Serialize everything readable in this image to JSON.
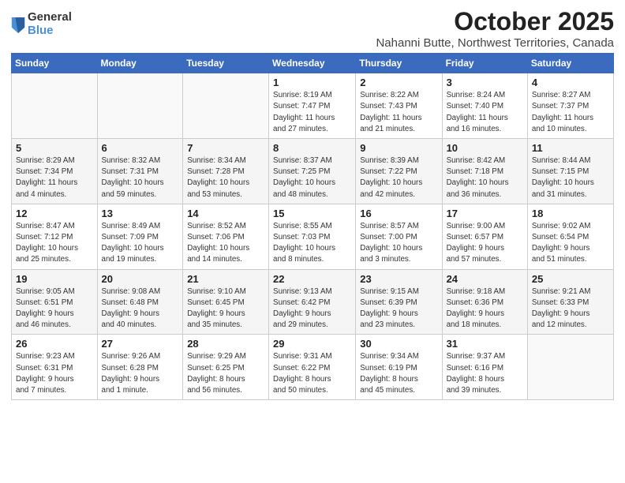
{
  "header": {
    "logo_general": "General",
    "logo_blue": "Blue",
    "month": "October 2025",
    "location": "Nahanni Butte, Northwest Territories, Canada"
  },
  "weekdays": [
    "Sunday",
    "Monday",
    "Tuesday",
    "Wednesday",
    "Thursday",
    "Friday",
    "Saturday"
  ],
  "weeks": [
    [
      {
        "day": "",
        "info": ""
      },
      {
        "day": "",
        "info": ""
      },
      {
        "day": "",
        "info": ""
      },
      {
        "day": "1",
        "info": "Sunrise: 8:19 AM\nSunset: 7:47 PM\nDaylight: 11 hours\nand 27 minutes."
      },
      {
        "day": "2",
        "info": "Sunrise: 8:22 AM\nSunset: 7:43 PM\nDaylight: 11 hours\nand 21 minutes."
      },
      {
        "day": "3",
        "info": "Sunrise: 8:24 AM\nSunset: 7:40 PM\nDaylight: 11 hours\nand 16 minutes."
      },
      {
        "day": "4",
        "info": "Sunrise: 8:27 AM\nSunset: 7:37 PM\nDaylight: 11 hours\nand 10 minutes."
      }
    ],
    [
      {
        "day": "5",
        "info": "Sunrise: 8:29 AM\nSunset: 7:34 PM\nDaylight: 11 hours\nand 4 minutes."
      },
      {
        "day": "6",
        "info": "Sunrise: 8:32 AM\nSunset: 7:31 PM\nDaylight: 10 hours\nand 59 minutes."
      },
      {
        "day": "7",
        "info": "Sunrise: 8:34 AM\nSunset: 7:28 PM\nDaylight: 10 hours\nand 53 minutes."
      },
      {
        "day": "8",
        "info": "Sunrise: 8:37 AM\nSunset: 7:25 PM\nDaylight: 10 hours\nand 48 minutes."
      },
      {
        "day": "9",
        "info": "Sunrise: 8:39 AM\nSunset: 7:22 PM\nDaylight: 10 hours\nand 42 minutes."
      },
      {
        "day": "10",
        "info": "Sunrise: 8:42 AM\nSunset: 7:18 PM\nDaylight: 10 hours\nand 36 minutes."
      },
      {
        "day": "11",
        "info": "Sunrise: 8:44 AM\nSunset: 7:15 PM\nDaylight: 10 hours\nand 31 minutes."
      }
    ],
    [
      {
        "day": "12",
        "info": "Sunrise: 8:47 AM\nSunset: 7:12 PM\nDaylight: 10 hours\nand 25 minutes."
      },
      {
        "day": "13",
        "info": "Sunrise: 8:49 AM\nSunset: 7:09 PM\nDaylight: 10 hours\nand 19 minutes."
      },
      {
        "day": "14",
        "info": "Sunrise: 8:52 AM\nSunset: 7:06 PM\nDaylight: 10 hours\nand 14 minutes."
      },
      {
        "day": "15",
        "info": "Sunrise: 8:55 AM\nSunset: 7:03 PM\nDaylight: 10 hours\nand 8 minutes."
      },
      {
        "day": "16",
        "info": "Sunrise: 8:57 AM\nSunset: 7:00 PM\nDaylight: 10 hours\nand 3 minutes."
      },
      {
        "day": "17",
        "info": "Sunrise: 9:00 AM\nSunset: 6:57 PM\nDaylight: 9 hours\nand 57 minutes."
      },
      {
        "day": "18",
        "info": "Sunrise: 9:02 AM\nSunset: 6:54 PM\nDaylight: 9 hours\nand 51 minutes."
      }
    ],
    [
      {
        "day": "19",
        "info": "Sunrise: 9:05 AM\nSunset: 6:51 PM\nDaylight: 9 hours\nand 46 minutes."
      },
      {
        "day": "20",
        "info": "Sunrise: 9:08 AM\nSunset: 6:48 PM\nDaylight: 9 hours\nand 40 minutes."
      },
      {
        "day": "21",
        "info": "Sunrise: 9:10 AM\nSunset: 6:45 PM\nDaylight: 9 hours\nand 35 minutes."
      },
      {
        "day": "22",
        "info": "Sunrise: 9:13 AM\nSunset: 6:42 PM\nDaylight: 9 hours\nand 29 minutes."
      },
      {
        "day": "23",
        "info": "Sunrise: 9:15 AM\nSunset: 6:39 PM\nDaylight: 9 hours\nand 23 minutes."
      },
      {
        "day": "24",
        "info": "Sunrise: 9:18 AM\nSunset: 6:36 PM\nDaylight: 9 hours\nand 18 minutes."
      },
      {
        "day": "25",
        "info": "Sunrise: 9:21 AM\nSunset: 6:33 PM\nDaylight: 9 hours\nand 12 minutes."
      }
    ],
    [
      {
        "day": "26",
        "info": "Sunrise: 9:23 AM\nSunset: 6:31 PM\nDaylight: 9 hours\nand 7 minutes."
      },
      {
        "day": "27",
        "info": "Sunrise: 9:26 AM\nSunset: 6:28 PM\nDaylight: 9 hours\nand 1 minute."
      },
      {
        "day": "28",
        "info": "Sunrise: 9:29 AM\nSunset: 6:25 PM\nDaylight: 8 hours\nand 56 minutes."
      },
      {
        "day": "29",
        "info": "Sunrise: 9:31 AM\nSunset: 6:22 PM\nDaylight: 8 hours\nand 50 minutes."
      },
      {
        "day": "30",
        "info": "Sunrise: 9:34 AM\nSunset: 6:19 PM\nDaylight: 8 hours\nand 45 minutes."
      },
      {
        "day": "31",
        "info": "Sunrise: 9:37 AM\nSunset: 6:16 PM\nDaylight: 8 hours\nand 39 minutes."
      },
      {
        "day": "",
        "info": ""
      }
    ]
  ]
}
